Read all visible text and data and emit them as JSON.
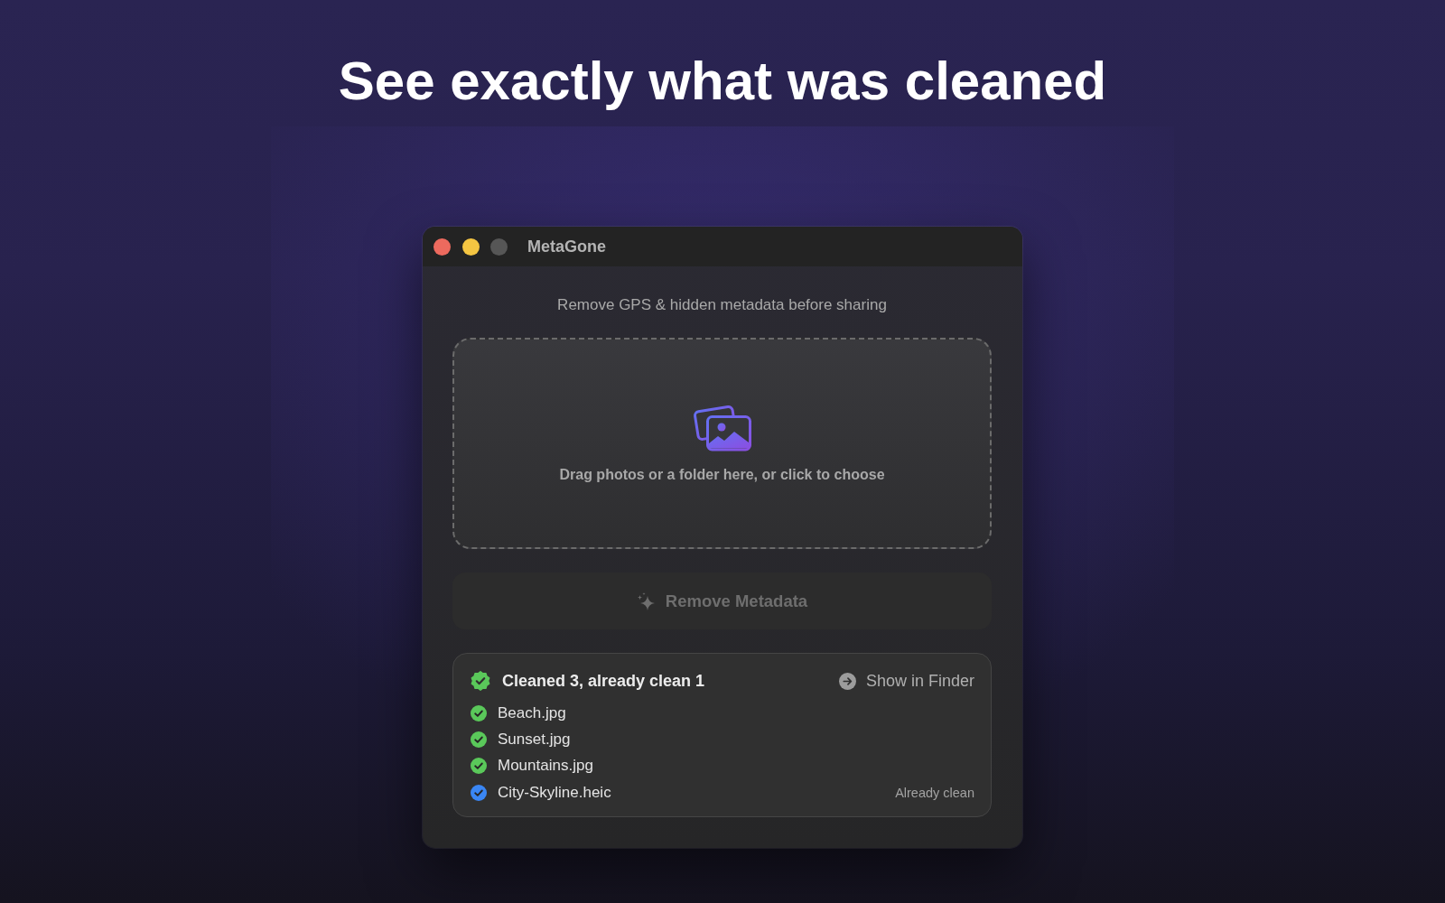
{
  "headline": "See exactly what was cleaned",
  "window": {
    "title": "MetaGone",
    "buttons": [
      {
        "kind": "close",
        "disabled": false
      },
      {
        "kind": "minimize",
        "disabled": false
      },
      {
        "kind": "zoom",
        "disabled": true
      }
    ]
  },
  "subtitle": "Remove GPS & hidden metadata before sharing",
  "drop_zone": {
    "label": "Drag photos or a folder here, or click to choose"
  },
  "remove_button": {
    "label": "Remove Metadata",
    "disabled": true
  },
  "results": {
    "summary": "Cleaned 3, already clean 1",
    "action": "Show in Finder",
    "files": [
      {
        "name": "Beach.jpg",
        "color": "#5ac85a"
      },
      {
        "name": "Sunset.jpg",
        "color": "#5ac85a"
      },
      {
        "name": "Mountains.jpg",
        "color": "#5ac85a"
      },
      {
        "name": "City-Skyline.heic",
        "color": "#3a86f4",
        "note": "Already clean"
      }
    ]
  }
}
